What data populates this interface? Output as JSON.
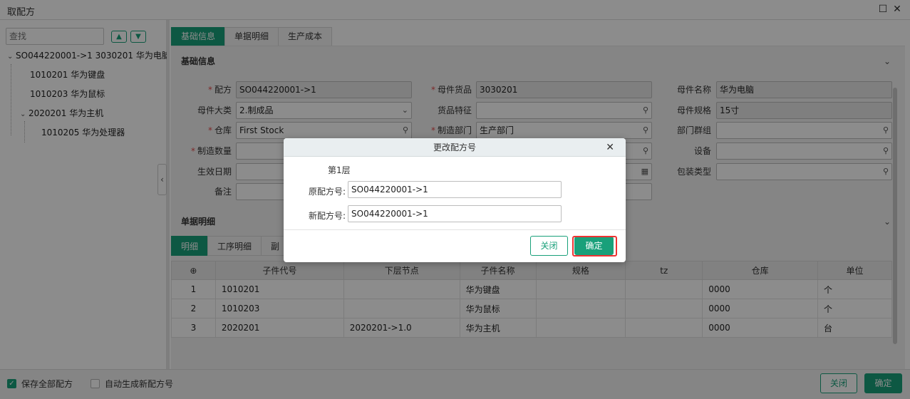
{
  "window": {
    "title": "取配方"
  },
  "left": {
    "search_placeholder": "查找",
    "tree": [
      {
        "label": "SO044220001->1 3030201 华为电脑"
      },
      {
        "label": "1010201 华为键盘"
      },
      {
        "label": "1010203 华为鼠标"
      },
      {
        "label": "2020201 华为主机"
      },
      {
        "label": "1010205 华为处理器"
      }
    ]
  },
  "tabs": [
    {
      "label": "基础信息"
    },
    {
      "label": "单据明细"
    },
    {
      "label": "生产成本"
    }
  ],
  "basic": {
    "header": "基础信息",
    "fields": {
      "recipe_label": "配方",
      "recipe_value": "SO044220001->1",
      "parent_goods_label": "母件货品",
      "parent_goods_value": "3030201",
      "parent_name_label": "母件名称",
      "parent_name_value": "华为电脑",
      "parent_category_label": "母件大类",
      "parent_category_value": "2.制成品",
      "goods_feature_label": "货品特征",
      "parent_spec_label": "母件规格",
      "parent_spec_value": "15寸",
      "warehouse_label": "仓库",
      "warehouse_value": "First Stock",
      "dept_label": "制造部门",
      "dept_value": "生产部门",
      "dept_group_label": "部门群组",
      "qty_label": "制造数量",
      "equipment_label": "设备",
      "effective_date_label": "生效日期",
      "package_type_label": "包装类型",
      "remark_label": "备注"
    }
  },
  "detail": {
    "header": "单据明细",
    "subtabs": [
      {
        "label": "明细"
      },
      {
        "label": "工序明细"
      },
      {
        "label": "副"
      }
    ],
    "columns": [
      "子件代号",
      "下层节点",
      "子件名称",
      "规格",
      "tz",
      "仓库",
      "单位"
    ],
    "rows": [
      {
        "no": "1",
        "code": "1010201",
        "node": "",
        "name": "华为键盘",
        "spec": "",
        "tz": "",
        "warehouse": "0000",
        "unit": "个"
      },
      {
        "no": "2",
        "code": "1010203",
        "node": "",
        "name": "华为鼠标",
        "spec": "",
        "tz": "",
        "warehouse": "0000",
        "unit": "个"
      },
      {
        "no": "3",
        "code": "2020201",
        "node": "2020201->1.0",
        "name": "华为主机",
        "spec": "",
        "tz": "",
        "warehouse": "0000",
        "unit": "台"
      }
    ]
  },
  "bottom": {
    "save_all_label": "保存全部配方",
    "auto_gen_label": "自动生成新配方号",
    "close_label": "关闭",
    "confirm_label": "确定"
  },
  "modal": {
    "title": "更改配方号",
    "layer": "第1层",
    "old_label": "原配方号:",
    "old_value": "SO044220001->1",
    "new_label": "新配方号:",
    "new_value": "SO044220001->1",
    "close_label": "关闭",
    "confirm_label": "确定"
  },
  "colors": {
    "accent": "#19a07a",
    "highlight": "#e33333"
  }
}
